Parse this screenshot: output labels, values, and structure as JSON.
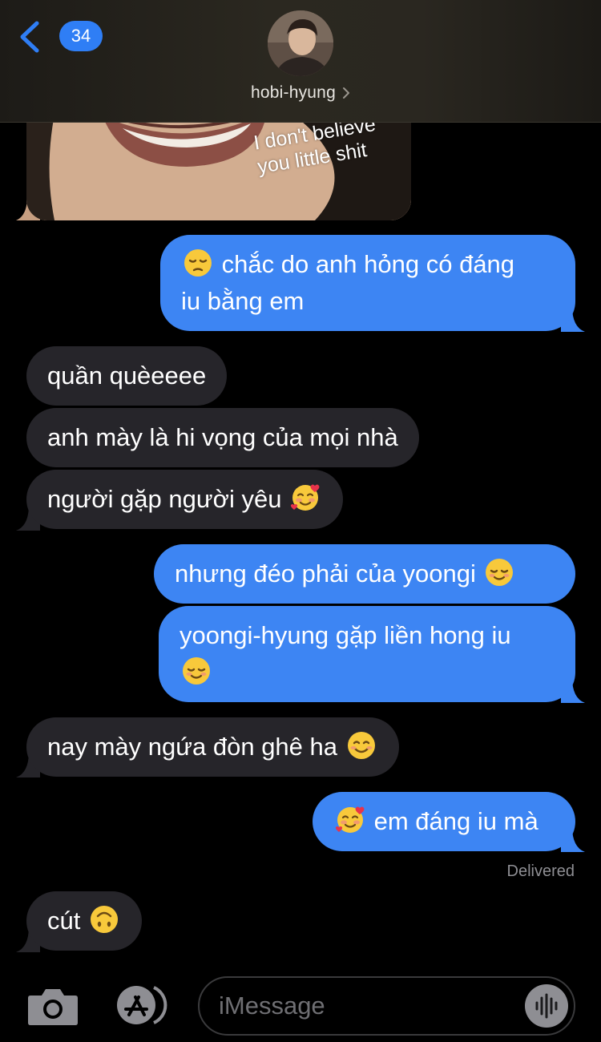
{
  "header": {
    "unread_count": "34",
    "contact_name": "hobi-hyung"
  },
  "photo_message": {
    "caption_line1": "I don't believe",
    "caption_line2": "you little shit"
  },
  "messages": [
    {
      "direction": "outgoing",
      "text_line1": "chắc do anh hỏng có đáng",
      "text_line2": "iu bằng em",
      "emoji": "pensive-face"
    },
    {
      "direction": "incoming",
      "text": "quần quèeeee"
    },
    {
      "direction": "incoming",
      "text": "anh mày là hi vọng của mọi nhà"
    },
    {
      "direction": "incoming",
      "text": "người gặp người yêu",
      "emoji": "smiling-face-with-hearts"
    },
    {
      "direction": "outgoing",
      "text": "nhưng đéo phải của yoongi",
      "emoji": "relieved-face"
    },
    {
      "direction": "outgoing",
      "text": "yoongi-hyung gặp liền hong iu",
      "emoji": "relieved-face"
    },
    {
      "direction": "incoming",
      "text": "nay mày ngứa đòn ghê ha",
      "emoji": "smiling-face"
    },
    {
      "direction": "outgoing",
      "text": "em đáng iu mà",
      "emoji": "smiling-face-with-hearts"
    },
    {
      "direction": "incoming",
      "text": "cút",
      "emoji": "upside-down-face"
    }
  ],
  "status": {
    "delivered": "Delivered"
  },
  "composer": {
    "placeholder": "iMessage"
  },
  "colors": {
    "outgoing_bubble": "#3d85f3",
    "incoming_bubble": "#26252a",
    "badge": "#2f7ef5"
  }
}
